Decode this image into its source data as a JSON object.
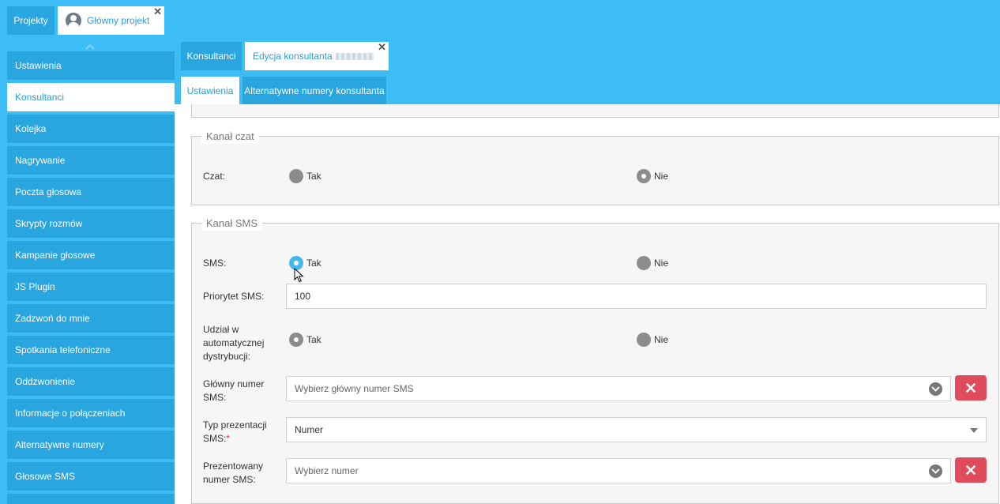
{
  "top_tabs": {
    "projects": "Projekty",
    "main_project": "Główny projekt"
  },
  "sidebar": {
    "items": [
      {
        "label": "Ustawienia"
      },
      {
        "label": "Konsultanci"
      },
      {
        "label": "Kolejka"
      },
      {
        "label": "Nagrywanie"
      },
      {
        "label": "Poczta głosowa"
      },
      {
        "label": "Skrypty rozmów"
      },
      {
        "label": "Kampanie głosowe"
      },
      {
        "label": "JS Plugin"
      },
      {
        "label": "Zadzwoń do mnie"
      },
      {
        "label": "Spotkania telefoniczne"
      },
      {
        "label": "Oddzwonienie"
      },
      {
        "label": "Informacje o połączeniach"
      },
      {
        "label": "Alternatywne numery"
      },
      {
        "label": "Głosowe SMS"
      }
    ],
    "active": "Konsultanci"
  },
  "content_tabs": {
    "consultants": "Konsultanci",
    "edit_consultant": "Edycja konsultanta"
  },
  "sub_tabs": {
    "settings": "Ustawienia",
    "alt_numbers": "Alternatywne numery konsultanta"
  },
  "chat_section": {
    "legend": "Kanał czat",
    "label": "Czat:",
    "yes": "Tak",
    "no": "Nie",
    "selected": "Nie"
  },
  "sms_section": {
    "legend": "Kanał SMS",
    "sms_label": "SMS:",
    "sms_yes": "Tak",
    "sms_no": "Nie",
    "sms_selected": "Tak",
    "priority_label": "Priorytet SMS:",
    "priority_value": "100",
    "auto_dist_label_1": "Udział w",
    "auto_dist_label_2": "automatycznej",
    "auto_dist_label_3": "dystrybucji:",
    "auto_yes": "Tak",
    "auto_no": "Nie",
    "auto_selected": "Tak",
    "main_number_label_1": "Główny numer",
    "main_number_label_2": "SMS:",
    "main_number_placeholder": "Wybierz główny numer SMS",
    "presentation_type_label_1": "Typ prezentacji",
    "presentation_type_label_2": "SMS:",
    "presentation_type_required": "*",
    "presentation_type_value": "Numer",
    "presented_number_label_1": "Prezentowany",
    "presented_number_label_2": "numer SMS:",
    "presented_number_placeholder": "Wybierz numer"
  },
  "colors": {
    "header_blue": "#3dbdf5",
    "tab_blue": "#29a5e0",
    "active_text": "#29a0da",
    "danger": "#e04b5b"
  }
}
